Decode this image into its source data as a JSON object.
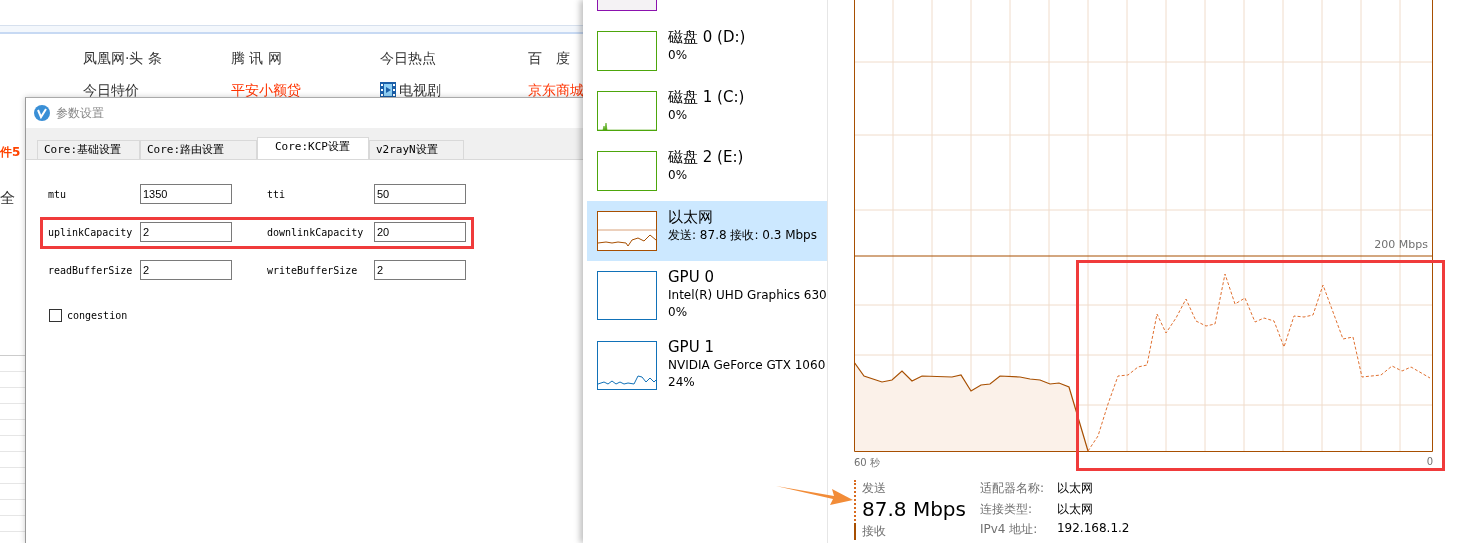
{
  "browser": {
    "nav_links": [
      {
        "text": "凤凰网·头 条",
        "kind": "plain"
      },
      {
        "text": "腾 讯 网",
        "kind": "plain"
      },
      {
        "text": "今日热点",
        "kind": "plain"
      },
      {
        "text": "百　度",
        "kind": "plain"
      },
      {
        "text": "今日特价",
        "kind": "plain"
      },
      {
        "text": "平安小额贷",
        "kind": "promo"
      },
      {
        "text": "电视剧",
        "kind": "media"
      },
      {
        "text": "京东商城",
        "kind": "promo"
      }
    ],
    "side_texts": [
      {
        "text": "件5",
        "kind": "promo"
      },
      {
        "text": "全",
        "kind": "plain"
      }
    ]
  },
  "dialog": {
    "title": "参数设置",
    "tabs": [
      {
        "label": "Core:基础设置",
        "selected": false
      },
      {
        "label": "Core:路由设置",
        "selected": false
      },
      {
        "label": "Core:KCP设置",
        "selected": true
      },
      {
        "label": "v2rayN设置",
        "selected": false
      }
    ],
    "fields": [
      {
        "label": "mtu",
        "value": "1350"
      },
      {
        "label": "tti",
        "value": "50"
      },
      {
        "label": "uplinkCapacity",
        "value": "2"
      },
      {
        "label": "downlinkCapacity",
        "value": "20"
      },
      {
        "label": "readBufferSize",
        "value": "2"
      },
      {
        "label": "writeBufferSize",
        "value": "2"
      }
    ],
    "checkbox": {
      "label": "congestion",
      "checked": false
    }
  },
  "task_manager": {
    "devices": [
      {
        "kind": "memory",
        "selected": false
      },
      {
        "kind": "disk",
        "name": "磁盘 0 (D:)",
        "lines": [
          "0%"
        ],
        "selected": false
      },
      {
        "kind": "disk",
        "name": "磁盘 1 (C:)",
        "lines": [
          "0%"
        ],
        "selected": false
      },
      {
        "kind": "disk",
        "name": "磁盘 2 (E:)",
        "lines": [
          "0%"
        ],
        "selected": false
      },
      {
        "kind": "network",
        "name": "以太网",
        "lines": [
          "发送: 87.8 接收: 0.3 Mbps"
        ],
        "selected": true
      },
      {
        "kind": "gpu",
        "name": "GPU 0",
        "lines": [
          "Intel(R) UHD Graphics 630",
          "0%"
        ],
        "selected": false
      },
      {
        "kind": "gpu",
        "name": "GPU 1",
        "lines": [
          "NVIDIA GeForce GTX 1060",
          "24%"
        ],
        "selected": false
      }
    ],
    "chart": {
      "scale_label": "200 Mbps",
      "x_start_label": "60 秒",
      "x_end_label": "0"
    },
    "send": {
      "label": "发送",
      "value": "87.8 Mbps"
    },
    "receive": {
      "label": "接收"
    },
    "properties": [
      {
        "label": "适配器名称:",
        "value": "以太网"
      },
      {
        "label": "连接类型:",
        "value": "以太网"
      },
      {
        "label": "IPv4 地址:",
        "value": "192.168.1.2"
      }
    ]
  }
}
